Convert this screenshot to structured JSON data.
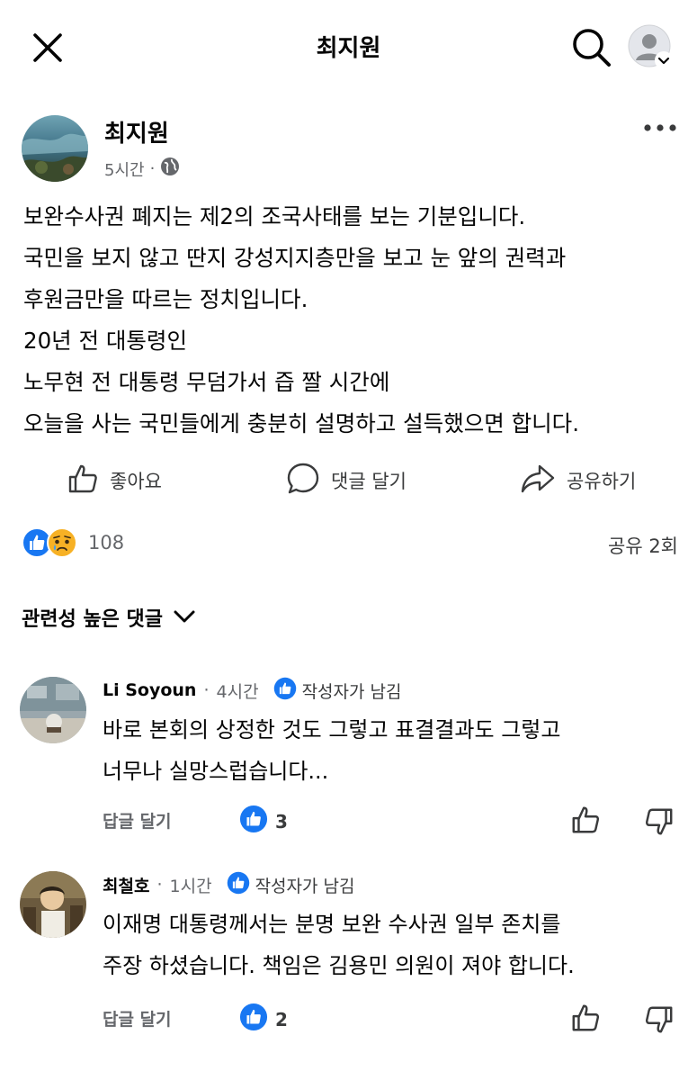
{
  "header": {
    "title": "최지원",
    "icons": {
      "close": "close-icon",
      "search": "search-icon",
      "profile": "profile-menu-icon"
    }
  },
  "post": {
    "author": "최지원",
    "time": "5시간",
    "separator": "·",
    "privacy_icon": "globe-icon",
    "lines": [
      "보완수사권 폐지는 제2의 조국사태를 보는 기분입니다.",
      "국민을 보지 않고 딴지 강성지지층만을 보고 눈 앞의 권력과",
      "후원금만을 따르는 정치입니다.",
      "20년 전 대통령인",
      "노무현 전 대통령 무덤가서 즙 짤 시간에",
      "오늘을 사는 국민들에게 충분히 설명하고 설득했으면 합니다."
    ]
  },
  "actions": {
    "like_label": "좋아요",
    "comment_label": "댓글 달기",
    "share_label": "공유하기"
  },
  "reactions": {
    "count": "108",
    "shares": "공유 2회",
    "icons": [
      "like-reaction-icon",
      "sad-reaction-icon"
    ]
  },
  "comments_sort": {
    "label": "관련성 높은 댓글"
  },
  "comments": [
    {
      "name": "Li Soyoun",
      "separator": "·",
      "time": "4시간",
      "badge": "작성자가 남김",
      "lines": [
        "바로 본회의 상정한 것도 그렇고 표결결과도 그렇고",
        "너무나 실망스럽습니다..."
      ],
      "reply_label": "답글 달기",
      "likes": "3"
    },
    {
      "name": "최철호",
      "separator": "·",
      "time": "1시간",
      "badge": "작성자가 남김",
      "lines": [
        "이재명 대통령께서는 분명 보완 수사권 일부 존치를",
        "주장 하셨습니다. 책임은 김용민 의원이 져야 합니다."
      ],
      "reply_label": "답글 달기",
      "likes": "2"
    }
  ],
  "colors": {
    "fb_blue": "#1877f2",
    "text_primary": "#050505",
    "text_secondary": "#65676b"
  }
}
